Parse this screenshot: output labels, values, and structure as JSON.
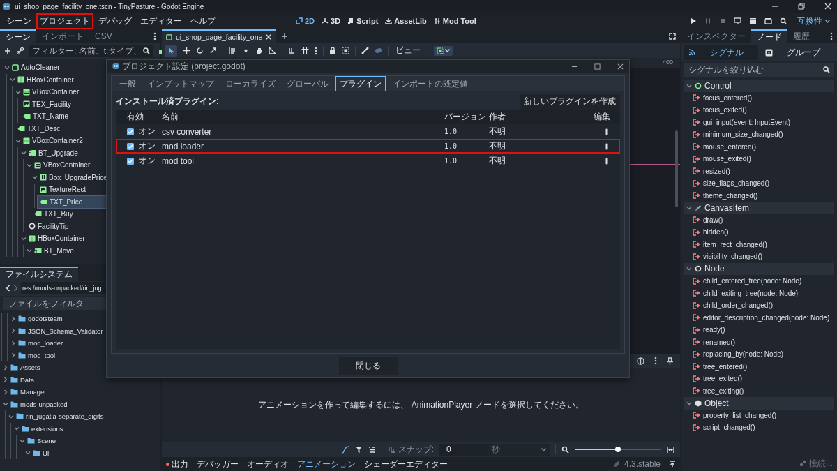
{
  "window": {
    "title": "ui_shop_page_facility_one.tscn - TinyPasture - Godot Engine"
  },
  "menu": [
    {
      "label": "シーン",
      "highlighted": false
    },
    {
      "label": "プロジェクト",
      "highlighted": true
    },
    {
      "label": "デバッグ",
      "highlighted": false
    },
    {
      "label": "エディター",
      "highlighted": false
    },
    {
      "label": "ヘルプ",
      "highlighted": false
    }
  ],
  "workspaces": [
    {
      "label": "2D",
      "kind": "planar",
      "selected": true
    },
    {
      "label": "3D",
      "kind": "spatial",
      "selected": false
    },
    {
      "label": "Script",
      "kind": "script",
      "selected": false
    },
    {
      "label": "AssetLib",
      "kind": "assetlib",
      "selected": false
    },
    {
      "label": "Mod Tool",
      "kind": "tool",
      "selected": false
    }
  ],
  "renderer": "互換性",
  "scene_dock": {
    "tabs": [
      {
        "label": "シーン",
        "selected": true
      },
      {
        "label": "インポート",
        "selected": false
      },
      {
        "label": "CSV",
        "selected": false
      }
    ],
    "filter": {
      "placeholder": "フィルター: 名前、t:タイプ、"
    },
    "tree": [
      {
        "label": "AutoCleaner",
        "kind": "panel",
        "selected": false,
        "expanded": true,
        "children": [
          {
            "label": "HBoxContainer",
            "kind": "hbox",
            "selected": false,
            "expanded": true,
            "children": [
              {
                "label": "VBoxContainer",
                "kind": "vbox",
                "selected": false,
                "expanded": true,
                "children": [
                  {
                    "label": "TEX_Facility",
                    "kind": "texture",
                    "selected": false
                  },
                  {
                    "label": "TXT_Name",
                    "kind": "label",
                    "selected": false
                  }
                ]
              },
              {
                "label": "TXT_Desc",
                "kind": "label",
                "selected": false
              },
              {
                "label": "VBoxContainer2",
                "kind": "vbox",
                "selected": false,
                "expanded": true,
                "children": [
                  {
                    "label": "BT_Upgrade",
                    "kind": "button",
                    "selected": false,
                    "expanded": true,
                    "children": [
                      {
                        "label": "VBoxContainer",
                        "kind": "vbox",
                        "selected": false,
                        "expanded": true,
                        "children": [
                          {
                            "label": "Box_UpgradePrice",
                            "kind": "hbox",
                            "selected": false,
                            "expanded": true,
                            "children": [
                              {
                                "label": "TextureRect",
                                "kind": "texture",
                                "selected": false
                              },
                              {
                                "label": "TXT_Price",
                                "kind": "label",
                                "selected": true
                              }
                            ]
                          },
                          {
                            "label": "TXT_Buy",
                            "kind": "label",
                            "selected": false
                          }
                        ]
                      },
                      {
                        "label": "FacilityTip",
                        "kind": "tip",
                        "selected": false
                      }
                    ]
                  },
                  {
                    "label": "HBoxContainer",
                    "kind": "hbox",
                    "selected": false,
                    "expanded": true,
                    "children": [
                      {
                        "label": "BT_Move",
                        "kind": "button",
                        "selected": false,
                        "expanded": true
                      }
                    ]
                  }
                ]
              }
            ]
          }
        ]
      }
    ]
  },
  "filesystem_dock": {
    "tab": "ファイルシステム",
    "path": "res://mods-unpacked/rin_jug",
    "filter": {
      "placeholder": "ファイルをフィルタ"
    },
    "tree": [
      {
        "children": [
          {
            "children": [
              {
                "label": "godotsteam",
                "expanded": false
              },
              {
                "label": "JSON_Schema_Validator",
                "expanded": false
              },
              {
                "label": "mod_loader",
                "expanded": false
              },
              {
                "label": "mod_tool",
                "expanded": false
              }
            ]
          }
        ]
      },
      {
        "label": "Assets",
        "expanded": false
      },
      {
        "label": "Data",
        "expanded": false
      },
      {
        "label": "Manager",
        "expanded": false
      },
      {
        "label": "mods-unpacked",
        "expanded": true,
        "children": [
          {
            "label": "rin_jugatla-separate_digits",
            "expanded": true,
            "children": [
              {
                "label": "extensions",
                "expanded": true,
                "children": [
                  {
                    "label": "Scene",
                    "expanded": true,
                    "children": [
                      {
                        "label": "UI",
                        "expanded": true
                      }
                    ]
                  }
                ]
              }
            ]
          }
        ]
      }
    ]
  },
  "editor_tabs": [
    {
      "label": "ui_shop_page_facility_one",
      "selected": true
    }
  ],
  "view_menu": "ビュー",
  "ruler_label": "400",
  "animation": {
    "message": "アニメーションを作って編集するには、 AnimationPlayer ノードを選択してください。",
    "snap_label": "スナップ:",
    "snap_value": "0",
    "snap_unit": "秒",
    "zoom": {
      "level": 0.5
    }
  },
  "bottom_tabs": [
    {
      "label": "出力",
      "kind": "output",
      "selected": false
    },
    {
      "label": "デバッガー",
      "kind": "plain",
      "selected": false
    },
    {
      "label": "オーディオ",
      "kind": "plain",
      "selected": false
    },
    {
      "label": "アニメーション",
      "kind": "plain",
      "selected": true
    },
    {
      "label": "シェーダーエディター",
      "kind": "plain",
      "selected": false
    }
  ],
  "version": "4.3.stable",
  "node_dock": {
    "tabs": [
      {
        "label": "インスペクター",
        "selected": false
      },
      {
        "label": "ノード",
        "selected": true
      },
      {
        "label": "履歴",
        "selected": false
      }
    ],
    "subtabs": [
      {
        "label": "シグナル",
        "kind": "signals",
        "selected": true
      },
      {
        "label": "グループ",
        "kind": "groups",
        "selected": false
      }
    ],
    "filter": {
      "placeholder": "シグナルを絞り込む"
    },
    "groups": [
      {
        "label": "Control",
        "kind": "control",
        "expanded": true,
        "signals": [
          "focus_entered()",
          "focus_exited()",
          "gui_input(event: InputEvent)",
          "minimum_size_changed()",
          "mouse_entered()",
          "mouse_exited()",
          "resized()",
          "size_flags_changed()",
          "theme_changed()"
        ]
      },
      {
        "label": "CanvasItem",
        "kind": "canvasitem",
        "expanded": true,
        "signals": [
          "draw()",
          "hidden()",
          "item_rect_changed()",
          "visibility_changed()"
        ]
      },
      {
        "label": "Node",
        "kind": "node",
        "expanded": true,
        "signals": [
          "child_entered_tree(node: Node)",
          "child_exiting_tree(node: Node)",
          "child_order_changed()",
          "editor_description_changed(node: Node)",
          "ready()",
          "renamed()",
          "replacing_by(node: Node)",
          "tree_entered()",
          "tree_exited()",
          "tree_exiting()"
        ]
      },
      {
        "label": "Object",
        "kind": "object",
        "expanded": true,
        "signals": [
          "property_list_changed()",
          "script_changed()"
        ]
      }
    ],
    "connect_button": {
      "label": "接続...",
      "disabled": true
    }
  },
  "dialog": {
    "title": "プロジェクト設定 (project.godot)",
    "tabs": [
      {
        "label": "一般",
        "selected": false
      },
      {
        "label": "インプットマップ",
        "selected": false
      },
      {
        "label": "ローカライズ",
        "selected": false
      },
      {
        "label": "グローバル",
        "selected": false
      },
      {
        "label": "プラグイン",
        "selected": true
      },
      {
        "label": "インポートの既定値",
        "selected": false
      }
    ],
    "heading": "インストール済プラグイン:",
    "create_button": "新しいプラグインを作成",
    "columns": [
      "有効",
      "名前",
      "バージョン",
      "作者",
      "編集"
    ],
    "plugins": [
      {
        "enabled": true,
        "status": "オン",
        "name": "csv converter",
        "version": "1.0",
        "author": "不明",
        "highlighted": false
      },
      {
        "enabled": true,
        "status": "オン",
        "name": "mod loader",
        "version": "1.0",
        "author": "不明",
        "highlighted": true
      },
      {
        "enabled": true,
        "status": "オン",
        "name": "mod tool",
        "version": "1.0",
        "author": "不明",
        "highlighted": false
      }
    ],
    "close_button": "閉じる"
  }
}
